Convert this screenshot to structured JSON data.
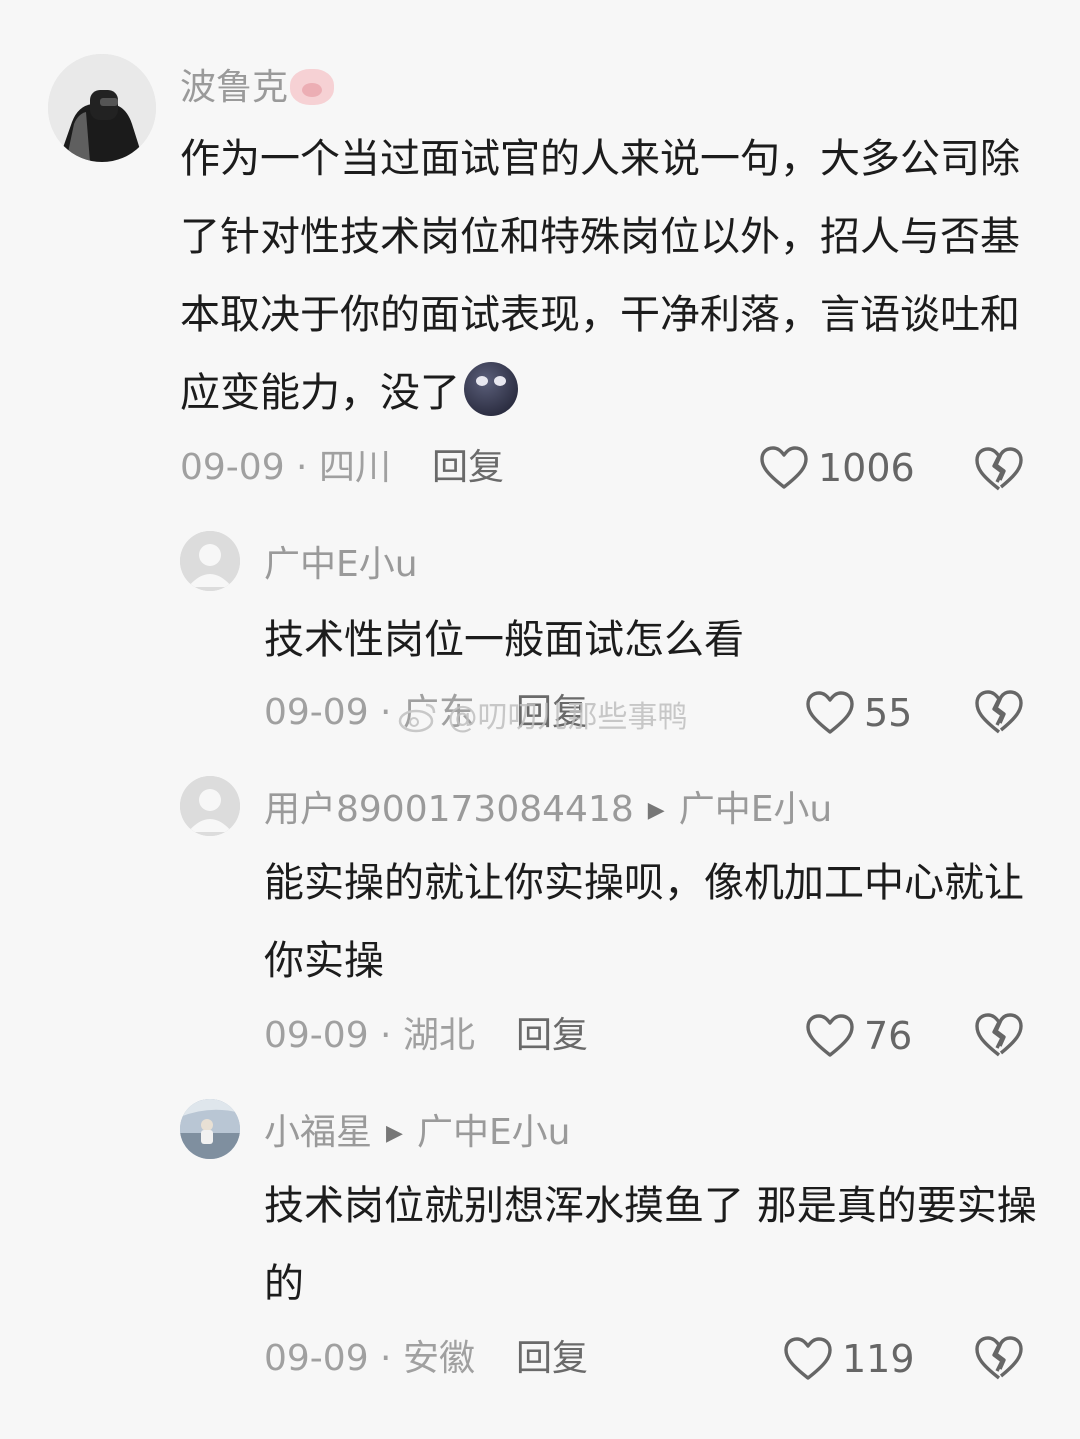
{
  "comments": [
    {
      "username": "波鲁克",
      "text": "作为一个当过面试官的人来说一句，大多公司除了针对性技术岗位和特殊岗位以外，招人与否基本取决于你的面试表现，干净利落，言语谈吐和应变能力，没了",
      "date": "09-09",
      "location": "四川",
      "reply_label": "回复",
      "likes": "1006"
    },
    {
      "username": "广中E小u",
      "text": "技术性岗位一般面试怎么看",
      "date": "09-09",
      "location": "广东",
      "reply_label": "回复",
      "likes": "55"
    },
    {
      "username": "用户8900173084418",
      "reply_to": "广中E小u",
      "text": "能实操的就让你实操呗，像机加工中心就让你实操",
      "date": "09-09",
      "location": "湖北",
      "reply_label": "回复",
      "likes": "76"
    },
    {
      "username": "小福星",
      "reply_to": "广中E小u",
      "text": "技术岗位就别想浑水摸鱼了 那是真的要实操的",
      "date": "09-09",
      "location": "安徽",
      "reply_label": "回复",
      "likes": "119"
    }
  ],
  "watermark": "@叨叨儿那些事鸭",
  "meta_separator": " · ",
  "icons": {
    "like": "heart-outline-icon",
    "dislike": "broken-heart-icon",
    "reply_arrow": "play-arrow-icon"
  }
}
